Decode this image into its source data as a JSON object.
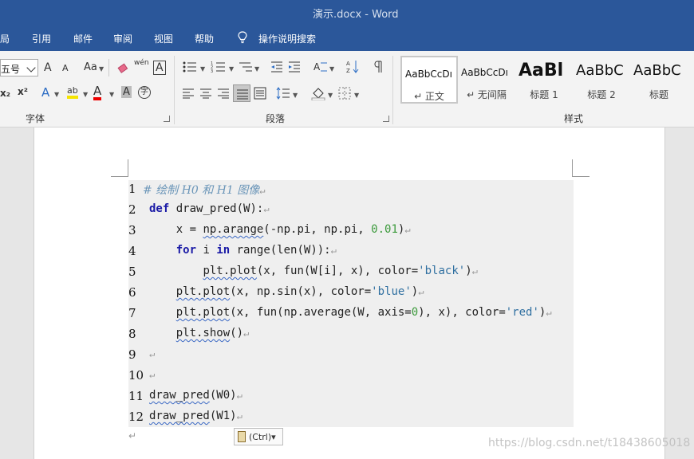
{
  "window": {
    "title": "演示.docx  -  Word"
  },
  "menu": {
    "items": [
      "局",
      "引用",
      "邮件",
      "审阅",
      "视图",
      "帮助"
    ],
    "tell_me": "操作说明搜索"
  },
  "ribbon": {
    "font": {
      "size_value": "五号",
      "grow_label": "A",
      "shrink_label": "A",
      "case_label": "Aa",
      "phonetic_label": "wén",
      "border_char_label": "A",
      "subscript_label": "x₂",
      "superscript_label": "x²",
      "effects_label": "A",
      "highlight_label": "ab",
      "color_label": "A",
      "shade_label": "A",
      "enclose_label": "字",
      "group_label": "字体"
    },
    "paragraph": {
      "group_label": "段落"
    },
    "styles": {
      "group_label": "样式",
      "items": [
        {
          "preview": "AaBbCcDı",
          "label": "↵ 正文"
        },
        {
          "preview": "AaBbCcDı",
          "label": "↵ 无间隔"
        },
        {
          "preview": "AaBl",
          "label": "标题 1"
        },
        {
          "preview": "AaBbC",
          "label": "标题 2"
        },
        {
          "preview": "AaBbC",
          "label": "标题"
        }
      ]
    }
  },
  "document": {
    "lines": [
      {
        "n": "1",
        "parts": [
          [
            "cm",
            "# 绘制 H0 和 H1 图像"
          ],
          [
            "pm",
            "↵"
          ]
        ]
      },
      {
        "n": "2",
        "parts": [
          [
            "kw",
            "def"
          ],
          [
            "",
            " draw_pred(W):"
          ],
          [
            "pm",
            "↵"
          ]
        ]
      },
      {
        "n": "3",
        "parts": [
          [
            "",
            "    x = "
          ],
          [
            "sq",
            "np.arange"
          ],
          [
            "",
            "(-np.pi, np.pi, "
          ],
          [
            "num",
            "0.01"
          ],
          [
            "",
            ")"
          ],
          [
            "pm",
            "↵"
          ]
        ]
      },
      {
        "n": "4",
        "parts": [
          [
            "",
            "    "
          ],
          [
            "kw",
            "for"
          ],
          [
            "",
            " i "
          ],
          [
            "kw",
            "in"
          ],
          [
            "",
            " range(len(W)):"
          ],
          [
            "pm",
            "↵"
          ]
        ]
      },
      {
        "n": "5",
        "parts": [
          [
            "",
            "        "
          ],
          [
            "sq",
            "plt.plot"
          ],
          [
            "",
            "(x, fun(W[i], x), color="
          ],
          [
            "str",
            "'black'"
          ],
          [
            "",
            ")"
          ],
          [
            "pm",
            "↵"
          ]
        ]
      },
      {
        "n": "6",
        "parts": [
          [
            "",
            "    "
          ],
          [
            "sq",
            "plt.plot"
          ],
          [
            "",
            "(x, np.sin(x), color="
          ],
          [
            "str",
            "'blue'"
          ],
          [
            "",
            ")"
          ],
          [
            "pm",
            "↵"
          ]
        ]
      },
      {
        "n": "7",
        "parts": [
          [
            "",
            "    "
          ],
          [
            "sq",
            "plt.plot"
          ],
          [
            "",
            "(x, fun(np.average(W, axis="
          ],
          [
            "num",
            "0"
          ],
          [
            "",
            "), x), color="
          ],
          [
            "str",
            "'red'"
          ],
          [
            "",
            ")"
          ],
          [
            "pm",
            "↵"
          ]
        ]
      },
      {
        "n": "8",
        "parts": [
          [
            "",
            "    "
          ],
          [
            "sq",
            "plt.show"
          ],
          [
            "",
            "()"
          ],
          [
            "pm",
            "↵"
          ]
        ]
      },
      {
        "n": "9",
        "parts": [
          [
            "pm",
            "↵"
          ]
        ]
      },
      {
        "n": "10",
        "parts": [
          [
            "pm",
            "↵"
          ]
        ]
      },
      {
        "n": "11",
        "parts": [
          [
            "sq",
            "draw_pred"
          ],
          [
            "",
            "(W0)"
          ],
          [
            "pm",
            "↵"
          ]
        ]
      },
      {
        "n": "12",
        "parts": [
          [
            "sq",
            "draw_pred"
          ],
          [
            "",
            "(W1)"
          ],
          [
            "pm",
            "↵"
          ]
        ]
      }
    ],
    "trailing_mark": "↵",
    "paste_options": "(Ctrl)▾"
  },
  "watermark": "https://blog.csdn.net/t18438605018",
  "colors": {
    "titlebar": "#2b579a",
    "ribbon": "#f3f3f3",
    "code_bg": "#efefef",
    "keyword": "#1a1aa6",
    "string": "#2f6fa0",
    "number": "#3c9a3c",
    "comment": "#6a95b8"
  }
}
